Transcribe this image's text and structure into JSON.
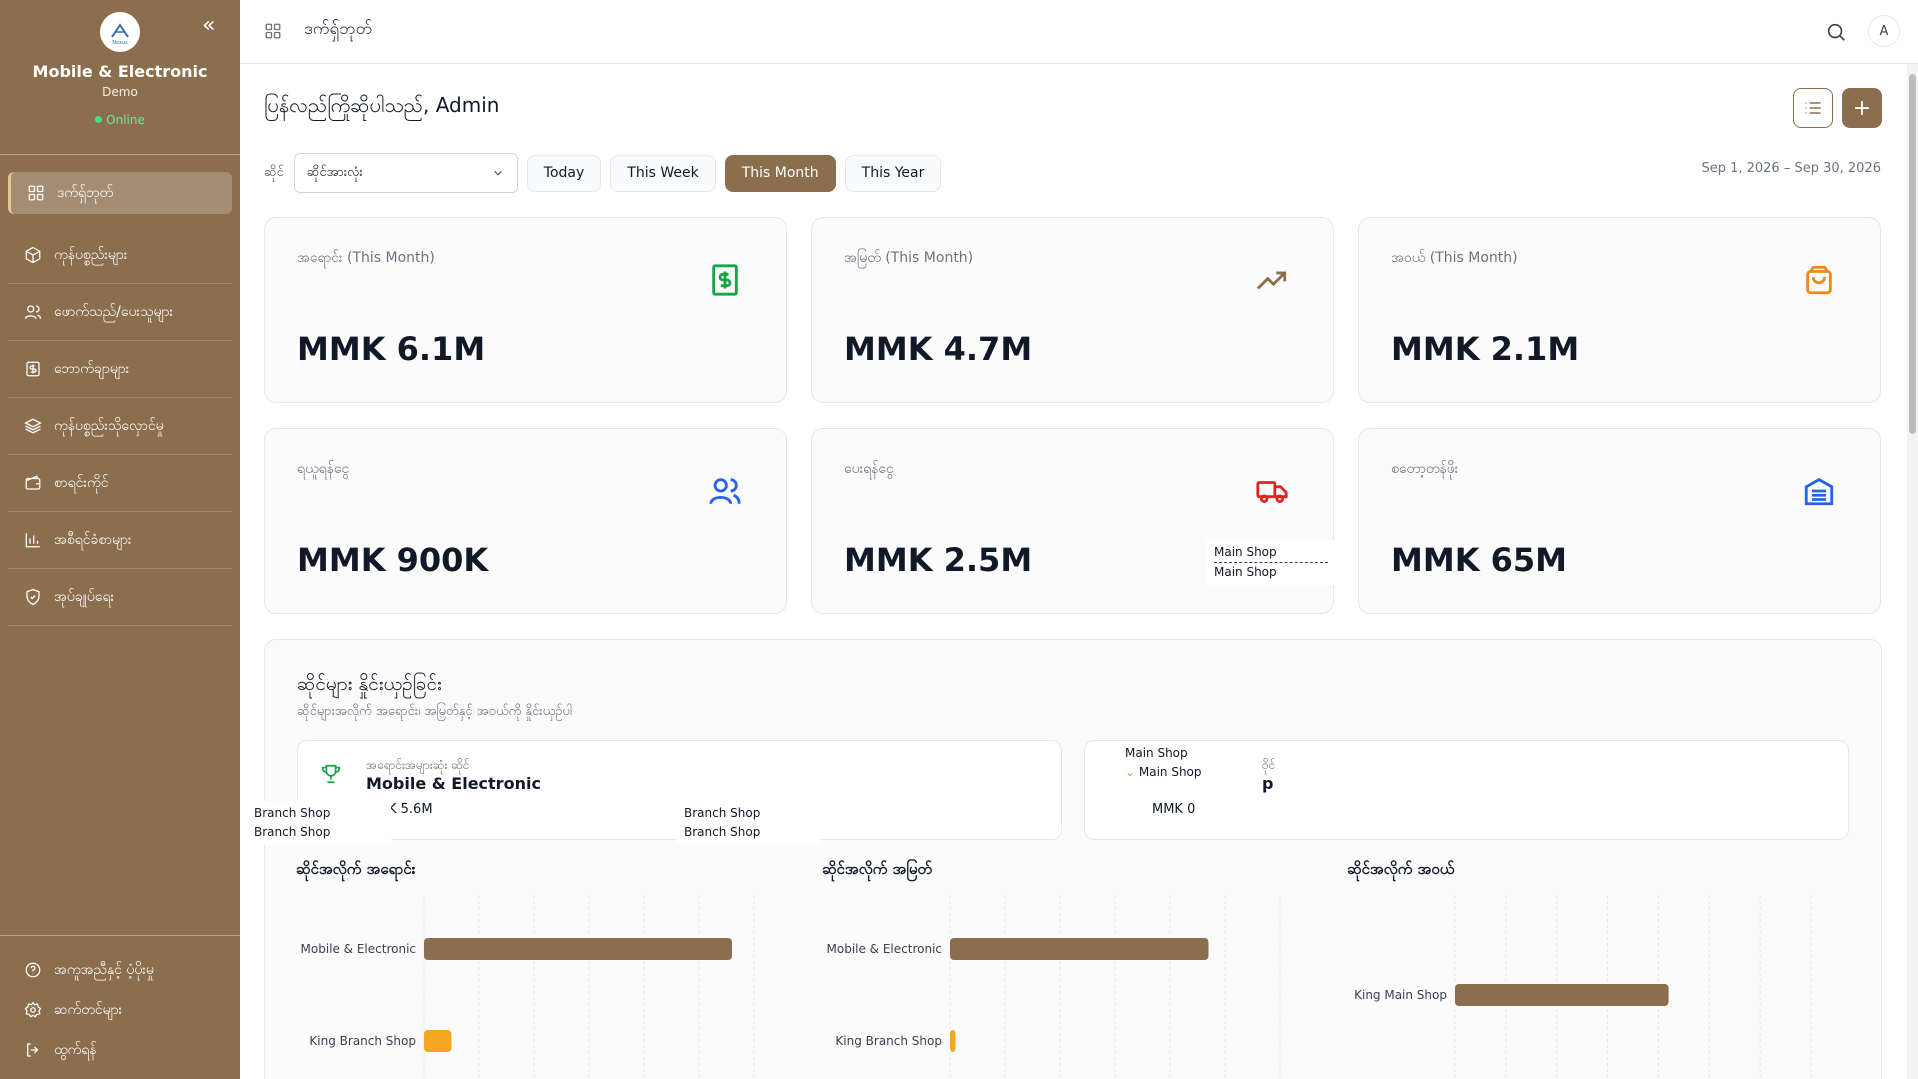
{
  "sidebar": {
    "logo_text": "Nexus",
    "app_name": "Mobile & Electronic",
    "subtitle": "Demo",
    "status": "Online",
    "items": [
      {
        "label": "ဒက်ရှ်ဘုတ်",
        "icon": "grid-icon"
      },
      {
        "label": "ကုန်ပစ္စည်းများ",
        "icon": "box-icon"
      },
      {
        "label": "ဖောက်သည်/ပေးသူများ",
        "icon": "users-icon"
      },
      {
        "label": "ဘောက်ချာများ",
        "icon": "receipt-icon"
      },
      {
        "label": "ကုန်ပစ္စည်းသိုလှောင်မှု",
        "icon": "layers-icon"
      },
      {
        "label": "စာရင်းကိုင်",
        "icon": "wallet-icon"
      },
      {
        "label": "အစီရင်ခံစာများ",
        "icon": "bar-chart-icon"
      },
      {
        "label": "အုပ်ချုပ်ရေး",
        "icon": "shield-icon"
      }
    ],
    "footer": [
      {
        "label": "အကူအညီနှင့် ပံ့ပိုးမှု",
        "icon": "help-icon"
      },
      {
        "label": "ဆက်တင်များ",
        "icon": "gear-icon"
      },
      {
        "label": "ထွက်ရန်",
        "icon": "logout-icon"
      }
    ]
  },
  "topbar": {
    "title": "ဒက်ရှ်ဘုတ်",
    "avatar": "A"
  },
  "main": {
    "welcome": "ပြန်လည်ကြိုဆိုပါသည်, Admin",
    "add_symbol": "+",
    "filters": {
      "shop_label": "ဆိုင်",
      "shop_value": "ဆိုင်အားလုံး",
      "periods": [
        "Today",
        "This Week",
        "This Month",
        "This Year"
      ],
      "active_period": "This Month",
      "date_range": "Sep 1, 2026 – Sep 30, 2026"
    },
    "cards": [
      {
        "label": "အရောင်း (This Month)",
        "value": "MMK 6.1M",
        "icon": "dollar-receipt-icon",
        "color": "#16a34a"
      },
      {
        "label": "အမြတ် (This Month)",
        "value": "MMK 4.7M",
        "icon": "trending-up-icon",
        "color": "#8b6e4e"
      },
      {
        "label": "အဝယ် (This Month)",
        "value": "MMK 2.1M",
        "icon": "shopping-bag-icon",
        "color": "#ea8a1e"
      },
      {
        "label": "ရယူရန်ငွေ",
        "value": "MMK 900K",
        "icon": "users-icon",
        "color": "#2563eb"
      },
      {
        "label": "ပေးရန်ငွေ",
        "value": "MMK 2.5M",
        "icon": "truck-icon",
        "color": "#dc2626"
      },
      {
        "label": "စတော့တန်ဖိုး",
        "value": "MMK 65M",
        "icon": "warehouse-icon",
        "color": "#2563eb"
      }
    ],
    "overview": {
      "title": "ဆိုင်များ နှိုင်းယှဉ်ခြင်း",
      "subtitle": "ဆိုင်များအလိုက် အရောင်း၊ အမြတ်နှင့် အဝယ်ကို နှိုင်းယှဉ်ပါ",
      "top_shop_label": "အရောင်းအများဆုံး ဆိုင်",
      "top_shop_name": "Mobile & Electronic",
      "top_shop_value": "K 5.6M",
      "second_label": "ဝိုင်",
      "second_name": "p",
      "second_value": "MMK 0"
    },
    "overlays": {
      "main_shop": "Main Shop",
      "branch_shop": "Branch Shop"
    }
  },
  "charts": {
    "sales_title": "ဆိုင်အလိုက် အရောင်း",
    "profit_title": "ဆိုင်အလိုက် အမြတ်",
    "purchase_title": "ဆိုင်အလိုက် အဝယ်"
  },
  "chart_data": [
    {
      "type": "bar",
      "orientation": "horizontal",
      "title": "ဆိုင်အလိုက် အရောင်း",
      "categories": [
        "Mobile & Electronic",
        "King Branch Shop"
      ],
      "values": [
        5.6,
        0.5
      ],
      "colors": [
        "#8b6e4e",
        "#f5a623"
      ],
      "xlim": [
        0,
        6
      ],
      "grid": true
    },
    {
      "type": "bar",
      "orientation": "horizontal",
      "title": "ဆိုင်အလိုက် အမြတ်",
      "categories": [
        "Mobile & Electronic",
        "King Branch Shop"
      ],
      "values": [
        4.7,
        0.1
      ],
      "colors": [
        "#8b6e4e",
        "#f5a623"
      ],
      "xlim": [
        0,
        6
      ],
      "grid": true
    },
    {
      "type": "bar",
      "orientation": "horizontal",
      "title": "ဆိုင်အလိုက် အဝယ်",
      "categories": [
        "King Main Shop"
      ],
      "values": [
        2.1
      ],
      "colors": [
        "#8b6e4e"
      ],
      "xlim": [
        0,
        3.5
      ],
      "grid": true
    }
  ]
}
